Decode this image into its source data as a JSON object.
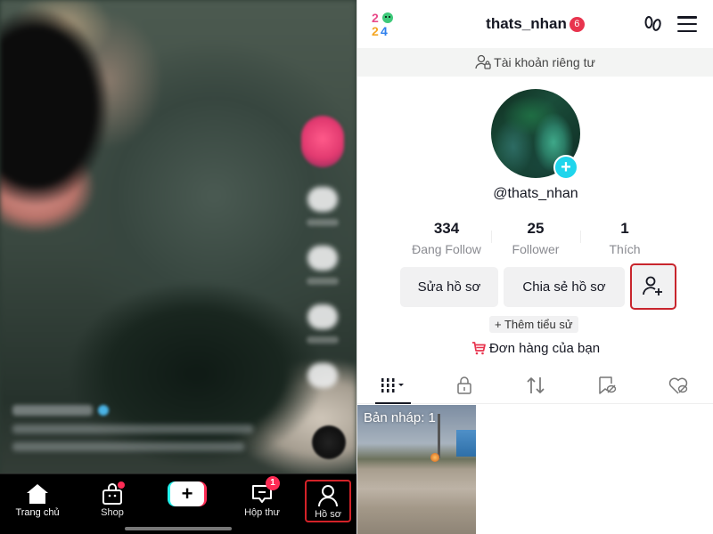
{
  "left_panel": {
    "bottom_nav": {
      "items": [
        {
          "label": "Trang chủ",
          "icon": "home-icon"
        },
        {
          "label": "Shop",
          "icon": "shopping-bag-icon",
          "has_dot": true
        },
        {
          "label": "",
          "icon": "create-plus-icon",
          "plus_symbol": "+"
        },
        {
          "label": "Hộp thư",
          "icon": "inbox-icon",
          "badge": "1"
        },
        {
          "label": "Hồ sơ",
          "icon": "profile-icon",
          "highlighted": true
        }
      ]
    }
  },
  "profile": {
    "header": {
      "username": "thats_nhan",
      "notification_badge": "6"
    },
    "private_account_label": "Tài khoản riêng tư",
    "avatar_add_symbol": "+",
    "handle": "@thats_nhan",
    "stats": [
      {
        "value": "334",
        "label": "Đang Follow"
      },
      {
        "value": "25",
        "label": "Follower"
      },
      {
        "value": "1",
        "label": "Thích"
      }
    ],
    "buttons": {
      "edit_profile": "Sửa hồ sơ",
      "share_profile": "Chia sẻ hồ sơ"
    },
    "add_bio": "+ Thêm tiểu sử",
    "orders": "Đơn hàng của bạn",
    "tabs": [
      {
        "name": "videos",
        "icon": "grid-icon",
        "active": true
      },
      {
        "name": "private",
        "icon": "lock-icon"
      },
      {
        "name": "reposts",
        "icon": "repost-icon"
      },
      {
        "name": "favorites",
        "icon": "bookmark-hidden-icon"
      },
      {
        "name": "liked",
        "icon": "heart-hidden-icon"
      }
    ],
    "drafts_label": "Bản nháp: 1"
  },
  "colors": {
    "accent_pink": "#fe2c55",
    "accent_cyan": "#25f4ee",
    "highlight_red": "#d32228",
    "avatar_plus": "#20d5ec"
  }
}
